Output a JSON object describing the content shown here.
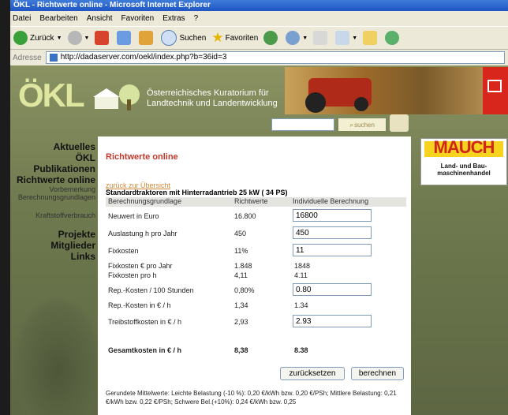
{
  "window": {
    "title": "ÖKL - Richtwerte online - Microsoft Internet Explorer"
  },
  "menu": [
    "Datei",
    "Bearbeiten",
    "Ansicht",
    "Favoriten",
    "Extras",
    "?"
  ],
  "toolbar": {
    "back": "Zurück",
    "search": "Suchen",
    "favorites": "Favoriten"
  },
  "address": {
    "label": "Adresse",
    "url": "http://dadaserver.com/oekl/index.php?b=36id=3"
  },
  "site": {
    "logo": "ÖKL",
    "org_line1": "Österreichisches Kuratorium für",
    "org_line2": "Landtechnik und Landentwicklung",
    "search_label": "suchen"
  },
  "nav": [
    {
      "label": "Aktuelles",
      "type": "main"
    },
    {
      "label": "ÖKL",
      "type": "main"
    },
    {
      "label": "Publikationen",
      "type": "main"
    },
    {
      "label": "Richtwerte online",
      "type": "main"
    },
    {
      "label": "Vorbemerkung",
      "type": "sub"
    },
    {
      "label": "Berechnungsgrundlagen",
      "type": "sub"
    },
    {
      "label": "Kraftstoffverbrauch",
      "type": "sub"
    },
    {
      "label": "Projekte",
      "type": "main"
    },
    {
      "label": "Mitglieder",
      "type": "main"
    },
    {
      "label": "Links",
      "type": "main"
    }
  ],
  "panel": {
    "title": "Richtwerte online",
    "back_link": "zurück zur Übersicht",
    "heading": "Standardtraktoren mit Hinterradantrieb 25 kW ( 34 PS)",
    "columns": [
      "Berechnungsgrundlage",
      "Richtwerte",
      "Individuelle Berechnung"
    ],
    "rows": [
      {
        "label": "Neuwert in Euro",
        "value": "16.800",
        "input": "16800"
      },
      {
        "label": "Auslastung h pro Jahr",
        "value": "450",
        "input": "450"
      },
      {
        "label": "Fixkosten",
        "value": "11%",
        "input": "11"
      },
      {
        "label": "Fixkosten € pro Jahr",
        "value": "1.848",
        "calc": "1848"
      },
      {
        "label": "Fixkosten pro h",
        "value": "4,11",
        "calc": "4.11"
      },
      {
        "label": "Rep.-Kosten / 100 Stunden",
        "value": "0,80%",
        "input": "0.80"
      },
      {
        "label": "Rep.-Kosten in € / h",
        "value": "1,34",
        "calc": "1.34"
      },
      {
        "label": "Treibstoffkosten in € / h",
        "value": "2,93",
        "input": "2.93"
      }
    ],
    "total": {
      "label": "Gesamtkosten in € / h",
      "value": "8,38",
      "calc": "8.38"
    },
    "reset_button": "zurücksetzen",
    "calc_button": "berechnen",
    "note": "Gerundete Mittelwerte: Leichte Belastung (-10 %): 0,20 €/kWh bzw. 0,20 €/PSh; Mittlere Belastung: 0,21 €/kWh bzw. 0,22 €/PSh; Schwere Bel.(+10%): 0,24 €/kWh bzw. 0,25"
  },
  "ad": {
    "brand": "MAUCH",
    "line1": "Land- und Bau-",
    "line2": "maschinenhandel"
  }
}
